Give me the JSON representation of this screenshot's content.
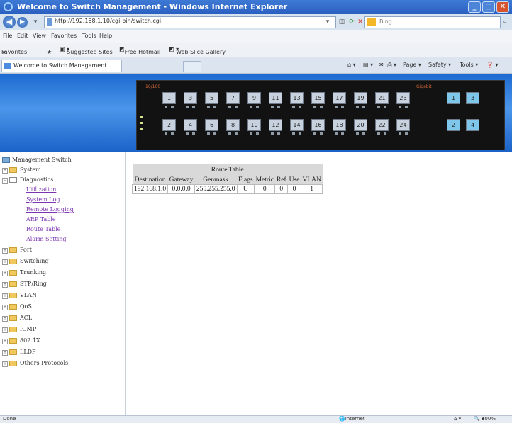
{
  "window": {
    "title": "Welcome to Switch Management - Windows Internet Explorer",
    "address": "http://192.168.1.10/cgi-bin/switch.cgi",
    "search_placeholder": "Bing"
  },
  "menu": [
    "File",
    "Edit",
    "View",
    "Favorites",
    "Tools",
    "Help"
  ],
  "favorites_bar": {
    "favorites": "Favorites",
    "suggested": "Suggested Sites",
    "hotmail": "Free Hotmail",
    "slices": "Web Slice Gallery"
  },
  "tab": {
    "title": "Welcome to Switch Management"
  },
  "command_bar": {
    "page": "Page",
    "safety": "Safety",
    "tools": "Tools"
  },
  "panel": {
    "label_10_100": "10/100",
    "label_gigabit": "Gigabit",
    "ports_top": [
      "1",
      "3",
      "5",
      "7",
      "9",
      "11",
      "13",
      "15",
      "17",
      "19",
      "21",
      "23"
    ],
    "ports_bottom": [
      "2",
      "4",
      "6",
      "8",
      "10",
      "12",
      "14",
      "16",
      "18",
      "20",
      "22",
      "24"
    ],
    "gigabit_top": "1",
    "gigabit_top2": "3",
    "gigabit_bottom": "2",
    "gigabit_bottom2": "4"
  },
  "sidebar": {
    "root": "Management Switch",
    "system": "System",
    "diagnostics": "Diagnostics",
    "diag_links": [
      "Utilization",
      "System Log",
      "Remote Logging",
      "ARP Table",
      "Route Table",
      "Alarm Setting"
    ],
    "folders": [
      "Port",
      "Switching",
      "Trunking",
      "STP/Ring",
      "VLAN",
      "QoS",
      "ACL",
      "IGMP",
      "802.1X",
      "LLDP",
      "Others Protocols"
    ]
  },
  "route_table": {
    "title": "Route Table",
    "columns": [
      "Destination",
      "Gateway",
      "Genmask",
      "Flags",
      "Metric",
      "Ref",
      "Use",
      "VLAN"
    ],
    "rows": [
      [
        "192.168.1.0",
        "0.0.0.0",
        "255.255.255.0",
        "U",
        "0",
        "0",
        "0",
        "1"
      ]
    ]
  },
  "status_bar": {
    "done": "Done",
    "zone": "Internet",
    "zoom": "100%"
  }
}
